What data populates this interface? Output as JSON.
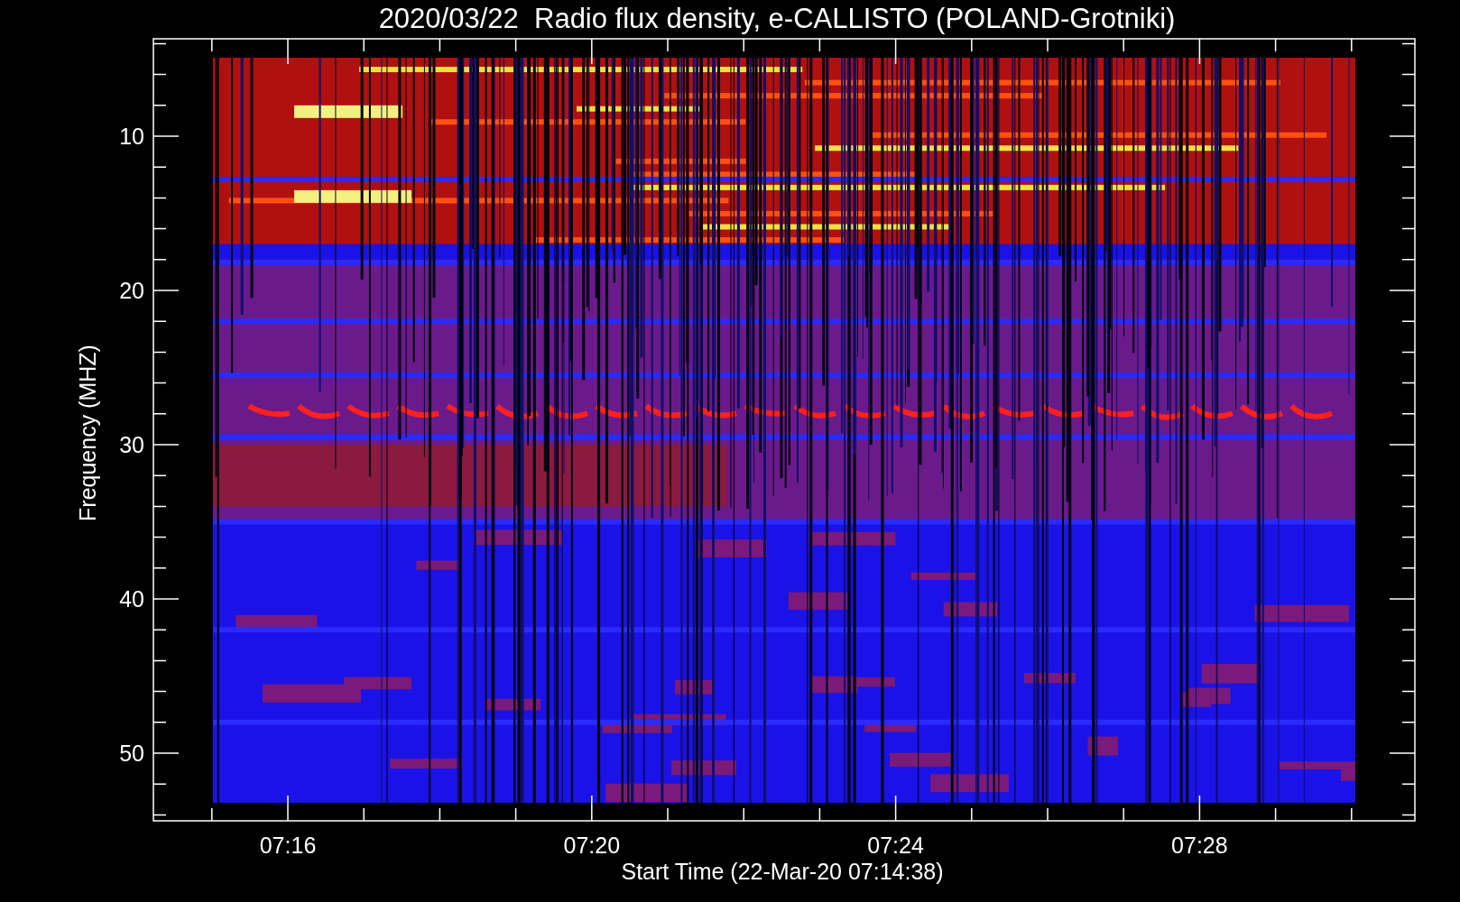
{
  "plot": {
    "title": "2020/03/22  Radio flux density, e-CALLISTO (POLAND-Grotniki)",
    "xlabel": "Start Time (22-Mar-20 07:14:38)",
    "ylabel": "Frequency (MHZ)",
    "xticks": [
      "07:16",
      "07:20",
      "07:24",
      "07:28"
    ],
    "yticks": [
      "10",
      "20",
      "30",
      "40",
      "50"
    ]
  }
}
